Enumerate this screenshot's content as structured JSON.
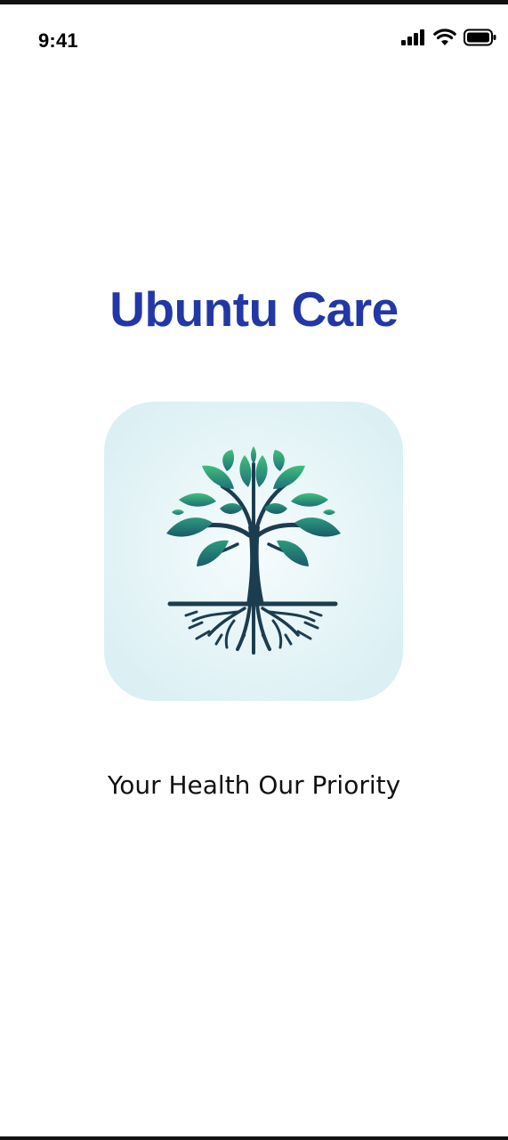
{
  "status_bar": {
    "time": "9:41",
    "icons": [
      "cellular-signal-icon",
      "wifi-icon",
      "battery-icon"
    ]
  },
  "app": {
    "title": "Ubuntu Care",
    "tagline": "Your Health Our Priority",
    "logo": "tree-of-life-logo"
  },
  "colors": {
    "title": "#2338a6",
    "tagline": "#111111",
    "tile_background": "#dcf0f4",
    "leaf_light": "#3dba7a",
    "leaf_dark": "#1f6f78",
    "trunk": "#1c3d4f"
  }
}
